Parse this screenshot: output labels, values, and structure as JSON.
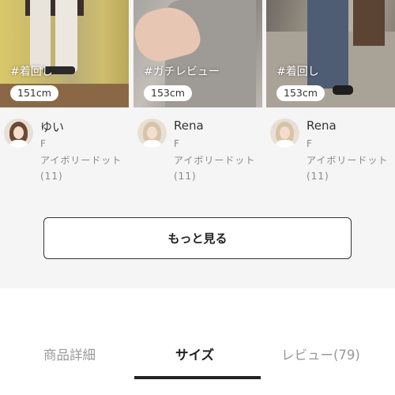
{
  "posts": [
    {
      "tag": "#着回し",
      "height": "151cm",
      "name": "ゆい",
      "gender": "F",
      "item": "アイボリードット(11)"
    },
    {
      "tag": "#ガチレビュー",
      "height": "153cm",
      "name": "Rena",
      "gender": "F",
      "item": "アイボリードット(11)"
    },
    {
      "tag": "#着回し",
      "height": "153cm",
      "name": "Rena",
      "gender": "F",
      "item": "アイボリードット(11)"
    }
  ],
  "more_button": {
    "label": "もっと見る"
  },
  "tabs": [
    {
      "label": "商品詳細"
    },
    {
      "label": "サイズ",
      "active": true
    },
    {
      "label": "レビュー(79)"
    }
  ]
}
